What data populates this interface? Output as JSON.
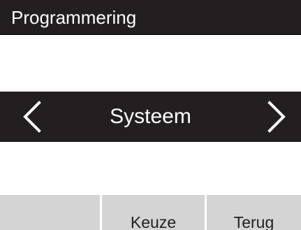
{
  "header": {
    "title": "Programmering"
  },
  "selector": {
    "value": "Systeem",
    "prev_icon": "chevron-left-icon",
    "next_icon": "chevron-right-icon"
  },
  "softkeys": [
    {
      "label": ""
    },
    {
      "label": "Keuze"
    },
    {
      "label": "Terug"
    }
  ],
  "colors": {
    "bar_background": "#231f20",
    "bar_text": "#ffffff",
    "softkey_background": "#d4d4d4",
    "softkey_text": "#231f20"
  }
}
